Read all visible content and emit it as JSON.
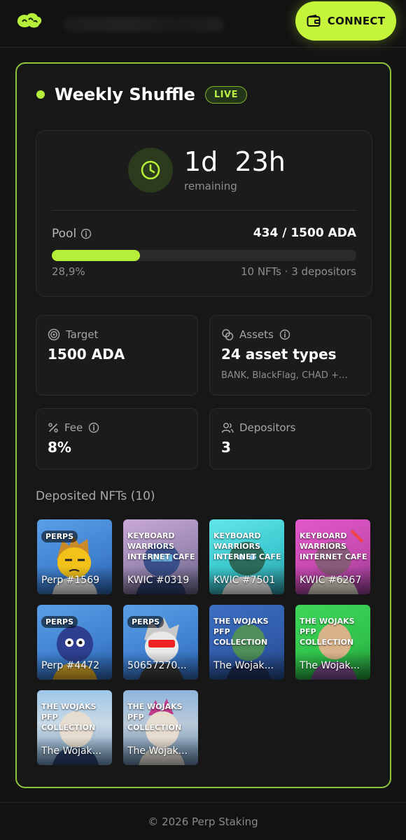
{
  "header": {
    "connect_label": "CONNECT"
  },
  "shuffle": {
    "title": "Weekly Shuffle",
    "status": "LIVE",
    "time_remaining": "1d  23h",
    "remaining_label": "remaining",
    "pool_label": "Pool",
    "pool_value": "434 / 1500 ADA",
    "pool_fraction": 0.289,
    "pool_percent_text": "28,9%",
    "pool_counts": "10 NFTs · 3 depositors"
  },
  "stats": {
    "target": {
      "label": "Target",
      "value": "1500 ADA"
    },
    "assets": {
      "label": "Assets",
      "value": "24 asset types",
      "sub": "BANK, BlackFlag, CHAD +…"
    },
    "fee": {
      "label": "Fee",
      "value": "8%"
    },
    "depositors": {
      "label": "Depositors",
      "value": "3"
    }
  },
  "deposited": {
    "heading": "Deposited NFTs (10)",
    "items": [
      {
        "collection": "PERPS",
        "name": "Perp #1569"
      },
      {
        "collection": "KEYBOARD WARRIORS INTERNET CAFE",
        "name": "KWIC #0319"
      },
      {
        "collection": "KEYBOARD WARRIORS INTERNET CAFE",
        "name": "KWIC #7501"
      },
      {
        "collection": "KEYBOARD WARRIORS INTERNET CAFE",
        "name": "KWIC #6267"
      },
      {
        "collection": "PERPS",
        "name": "Perp #4472"
      },
      {
        "collection": "PERPS",
        "name": "50657270..."
      },
      {
        "collection": "THE WOJAKS PFP COLLECTION",
        "name": "The Wojak..."
      },
      {
        "collection": "THE WOJAKS PFP COLLECTION",
        "name": "The Wojak..."
      },
      {
        "collection": "THE WOJAKS PFP COLLECTION",
        "name": "The Wojak..."
      },
      {
        "collection": "THE WOJAKS PFP COLLECTION",
        "name": "The Wojak..."
      }
    ]
  },
  "footer": {
    "text": "© 2026 Perp Staking"
  },
  "colors": {
    "accent": "#c4f53a",
    "border": "#8fc33a"
  }
}
